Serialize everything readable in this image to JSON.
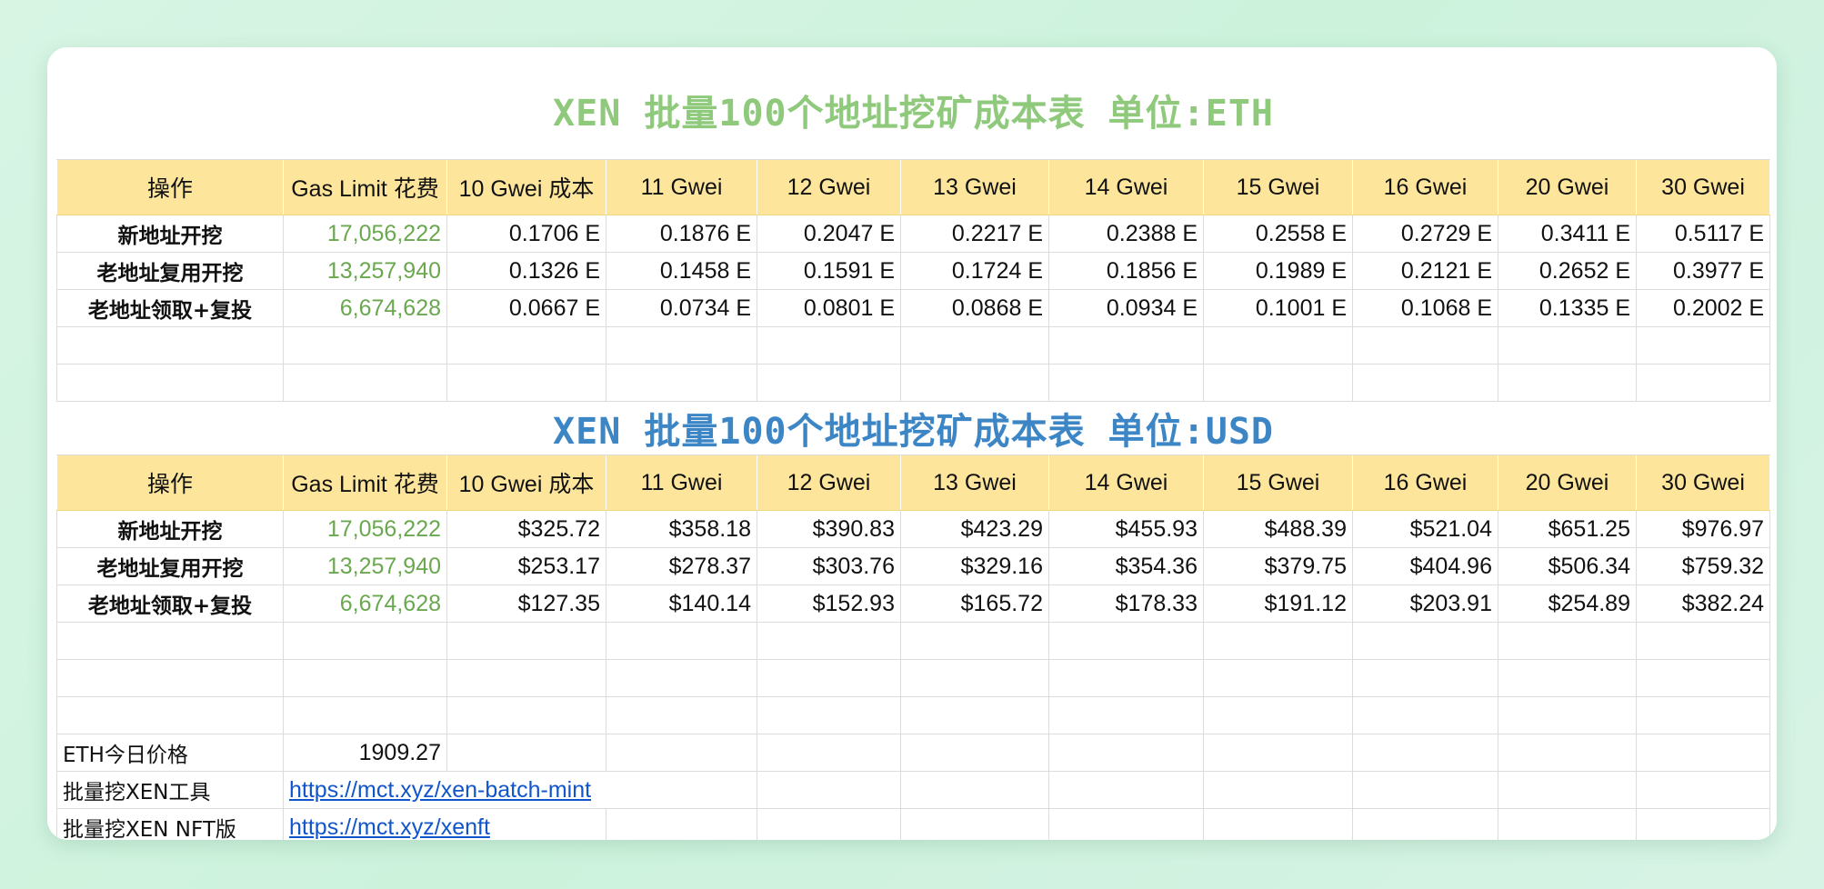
{
  "eth_table": {
    "title": "XEN 批量100个地址挖矿成本表 单位:ETH",
    "headers": [
      "操作",
      "Gas Limit 花费",
      "10 Gwei 成本",
      "11 Gwei",
      "12 Gwei",
      "13 Gwei",
      "14 Gwei",
      "15 Gwei",
      "16 Gwei",
      "20 Gwei",
      "30 Gwei"
    ],
    "rows": [
      {
        "op": "新地址开挖",
        "gas": "17,056,222",
        "values": [
          "0.1706 E",
          "0.1876 E",
          "0.2047 E",
          "0.2217 E",
          "0.2388 E",
          "0.2558 E",
          "0.2729 E",
          "0.3411 E",
          "0.5117 E"
        ]
      },
      {
        "op": "老地址复用开挖",
        "gas": "13,257,940",
        "values": [
          "0.1326 E",
          "0.1458 E",
          "0.1591 E",
          "0.1724 E",
          "0.1856 E",
          "0.1989 E",
          "0.2121 E",
          "0.2652 E",
          "0.3977 E"
        ]
      },
      {
        "op": "老地址领取+复投",
        "gas": "6,674,628",
        "values": [
          "0.0667 E",
          "0.0734 E",
          "0.0801 E",
          "0.0868 E",
          "0.0934 E",
          "0.1001 E",
          "0.1068 E",
          "0.1335 E",
          "0.2002 E"
        ]
      }
    ]
  },
  "usd_table": {
    "title": "XEN 批量100个地址挖矿成本表 单位:USD",
    "headers": [
      "操作",
      "Gas Limit 花费",
      "10 Gwei 成本",
      "11 Gwei",
      "12 Gwei",
      "13 Gwei",
      "14 Gwei",
      "15 Gwei",
      "16 Gwei",
      "20 Gwei",
      "30 Gwei"
    ],
    "rows": [
      {
        "op": "新地址开挖",
        "gas": "17,056,222",
        "values": [
          "$325.72",
          "$358.18",
          "$390.83",
          "$423.29",
          "$455.93",
          "$488.39",
          "$521.04",
          "$651.25",
          "$976.97"
        ]
      },
      {
        "op": "老地址复用开挖",
        "gas": "13,257,940",
        "values": [
          "$253.17",
          "$278.37",
          "$303.76",
          "$329.16",
          "$354.36",
          "$379.75",
          "$404.96",
          "$506.34",
          "$759.32"
        ]
      },
      {
        "op": "老地址领取+复投",
        "gas": "6,674,628",
        "values": [
          "$127.35",
          "$140.14",
          "$152.93",
          "$165.72",
          "$178.33",
          "$191.12",
          "$203.91",
          "$254.89",
          "$382.24"
        ]
      }
    ]
  },
  "footer": {
    "eth_price_label": "ETH今日价格",
    "eth_price_value": "1909.27",
    "tool_label": "批量挖XEN工具",
    "tool_link": "https://mct.xyz/xen-batch-mint",
    "nft_label": "批量挖XEN NFT版",
    "nft_link": "https://mct.xyz/xenft"
  },
  "colors": {
    "eth_title": "#8fc97c",
    "usd_title": "#3d86c6",
    "header_bg": "#fde69b",
    "gas_text": "#6aa84f",
    "link": "#1155cc"
  }
}
